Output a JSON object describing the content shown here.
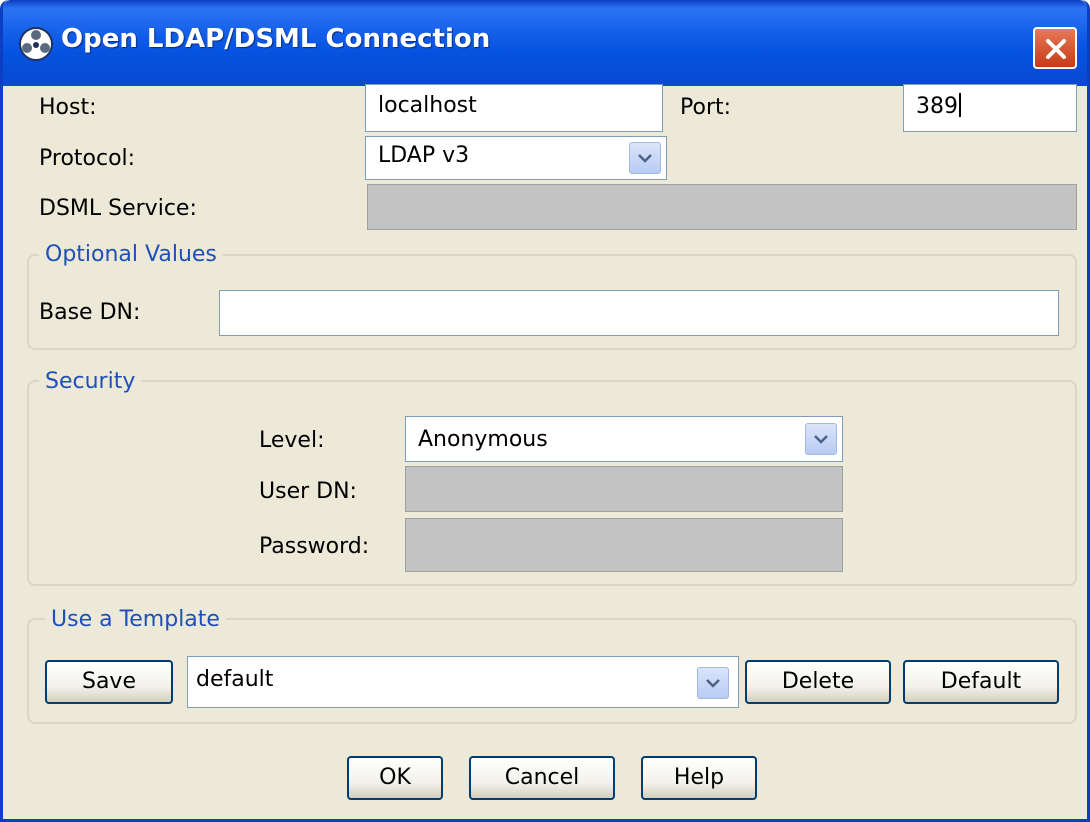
{
  "window": {
    "title": "Open LDAP/DSML Connection",
    "icon": "ldap-connection-icon",
    "close_icon": "close-icon"
  },
  "connection": {
    "host_label": "Host:",
    "host_value": "localhost",
    "port_label": "Port:",
    "port_value": "389",
    "protocol_label": "Protocol:",
    "protocol_value": "LDAP v3",
    "dsml_label": "DSML Service:",
    "dsml_value": ""
  },
  "optional": {
    "legend": "Optional Values",
    "base_dn_label": "Base DN:",
    "base_dn_value": ""
  },
  "security": {
    "legend": "Security",
    "level_label": "Level:",
    "level_value": "Anonymous",
    "user_dn_label": "User DN:",
    "user_dn_value": "",
    "password_label": "Password:",
    "password_value": ""
  },
  "template": {
    "legend": "Use a Template",
    "save_label": "Save",
    "selected": "default",
    "delete_label": "Delete",
    "default_label": "Default"
  },
  "buttons": {
    "ok": "OK",
    "cancel": "Cancel",
    "help": "Help"
  },
  "colors": {
    "titlebar": "#0553e0",
    "window_bg": "#ece9d8",
    "legend_text": "#1f4fb8",
    "disabled_field": "#c3c3c3",
    "close_button": "#d0502a"
  }
}
